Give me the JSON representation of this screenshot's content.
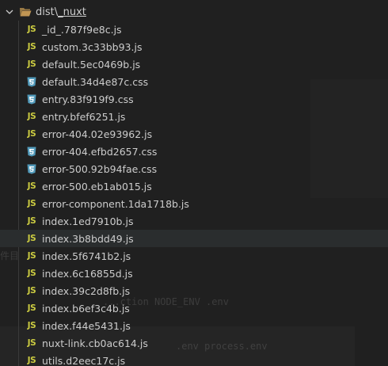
{
  "breadcrumb": {
    "parent": "dist",
    "separator": "\\",
    "current": "_nuxt"
  },
  "colors": {
    "js_icon": "#cbcb41",
    "css_icon": "#519aba",
    "folder_icon": "#c09553",
    "text": "#cccccc",
    "background": "#202020",
    "selected_row": "#2a2d2e"
  },
  "files": [
    {
      "name": "_id_.787f9e8c.js",
      "type": "js",
      "icon": "js-icon"
    },
    {
      "name": "custom.3c33bb93.js",
      "type": "js",
      "icon": "js-icon"
    },
    {
      "name": "default.5ec0469b.js",
      "type": "js",
      "icon": "js-icon"
    },
    {
      "name": "default.34d4e87c.css",
      "type": "css",
      "icon": "css-icon"
    },
    {
      "name": "entry.83f919f9.css",
      "type": "css",
      "icon": "css-icon"
    },
    {
      "name": "entry.bfef6251.js",
      "type": "js",
      "icon": "js-icon"
    },
    {
      "name": "error-404.02e93962.js",
      "type": "js",
      "icon": "js-icon"
    },
    {
      "name": "error-404.efbd2657.css",
      "type": "css",
      "icon": "css-icon"
    },
    {
      "name": "error-500.92b94fae.css",
      "type": "css",
      "icon": "css-icon"
    },
    {
      "name": "error-500.eb1ab015.js",
      "type": "js",
      "icon": "js-icon"
    },
    {
      "name": "error-component.1da1718b.js",
      "type": "js",
      "icon": "js-icon"
    },
    {
      "name": "index.1ed7910b.js",
      "type": "js",
      "icon": "js-icon"
    },
    {
      "name": "index.3b8bdd49.js",
      "type": "js",
      "icon": "js-icon",
      "selected": true
    },
    {
      "name": "index.5f6741b2.js",
      "type": "js",
      "icon": "js-icon"
    },
    {
      "name": "index.6c16855d.js",
      "type": "js",
      "icon": "js-icon"
    },
    {
      "name": "index.39c2d8fb.js",
      "type": "js",
      "icon": "js-icon"
    },
    {
      "name": "index.b6ef3c4b.js",
      "type": "js",
      "icon": "js-icon"
    },
    {
      "name": "index.f44e5431.js",
      "type": "js",
      "icon": "js-icon"
    },
    {
      "name": "nuxt-link.cb0ac614.js",
      "type": "js",
      "icon": "js-icon"
    },
    {
      "name": "utils.d2eec17c.js",
      "type": "js",
      "icon": "js-icon"
    }
  ],
  "js_label": "JS",
  "ghost_text": {
    "line1": "...ction NODE_ENV .env",
    "line2": ".env process.env",
    "line3": "件目"
  }
}
